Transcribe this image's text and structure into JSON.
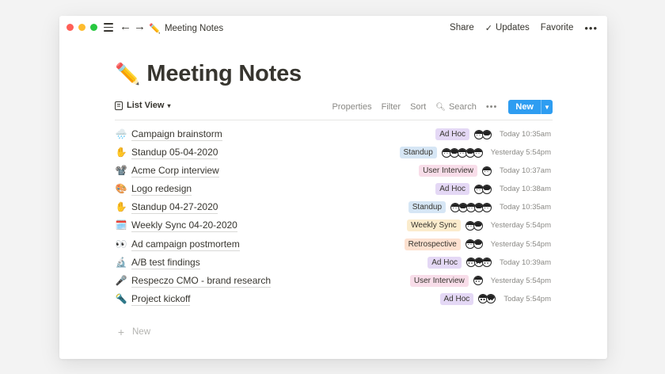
{
  "app": {
    "breadcrumb_icon": "✏️",
    "breadcrumb_label": "Meeting Notes",
    "share_label": "Share",
    "updates_label": "Updates",
    "favorite_label": "Favorite",
    "more_label": "•••"
  },
  "page": {
    "icon": "✏️",
    "title": "Meeting Notes"
  },
  "toolbar": {
    "view_label": "List View",
    "properties_label": "Properties",
    "filter_label": "Filter",
    "sort_label": "Sort",
    "search_label": "Search",
    "more_label": "•••",
    "new_label": "New"
  },
  "tag_colors": {
    "Ad Hoc": "#e4d8f5",
    "Standup": "#d6e6f5",
    "User Interview": "#f8dde9",
    "Weekly Sync": "#fbeccd",
    "Retrospective": "#fde1d0"
  },
  "rows": [
    {
      "icon": "🌧️",
      "title": "Campaign brainstorm",
      "tag": "Ad Hoc",
      "avatars": 2,
      "time": "Today 10:35am"
    },
    {
      "icon": "✋",
      "title": "Standup 05-04-2020",
      "tag": "Standup",
      "avatars": 5,
      "time": "Yesterday 5:54pm"
    },
    {
      "icon": "📽️",
      "title": "Acme Corp interview",
      "tag": "User Interview",
      "avatars": 1,
      "time": "Today 10:37am"
    },
    {
      "icon": "🎨",
      "title": "Logo redesign",
      "tag": "Ad Hoc",
      "avatars": 2,
      "time": "Today 10:38am"
    },
    {
      "icon": "✋",
      "title": "Standup 04-27-2020",
      "tag": "Standup",
      "avatars": 5,
      "time": "Today 10:35am"
    },
    {
      "icon": "🗓️",
      "title": "Weekly Sync 04-20-2020",
      "tag": "Weekly Sync",
      "avatars": 2,
      "time": "Yesterday 5:54pm"
    },
    {
      "icon": "👀",
      "title": "Ad campaign postmortem",
      "tag": "Retrospective",
      "avatars": 2,
      "time": "Yesterday 5:54pm"
    },
    {
      "icon": "🔬",
      "title": "A/B test findings",
      "tag": "Ad Hoc",
      "avatars": 3,
      "time": "Today 10:39am"
    },
    {
      "icon": "🎤",
      "title": "Respeczo CMO - brand research",
      "tag": "User Interview",
      "avatars": 1,
      "time": "Yesterday 5:54pm"
    },
    {
      "icon": "🔦",
      "title": "Project kickoff",
      "tag": "Ad Hoc",
      "avatars": 2,
      "time": "Today 5:54pm"
    }
  ],
  "new_row_label": "New"
}
